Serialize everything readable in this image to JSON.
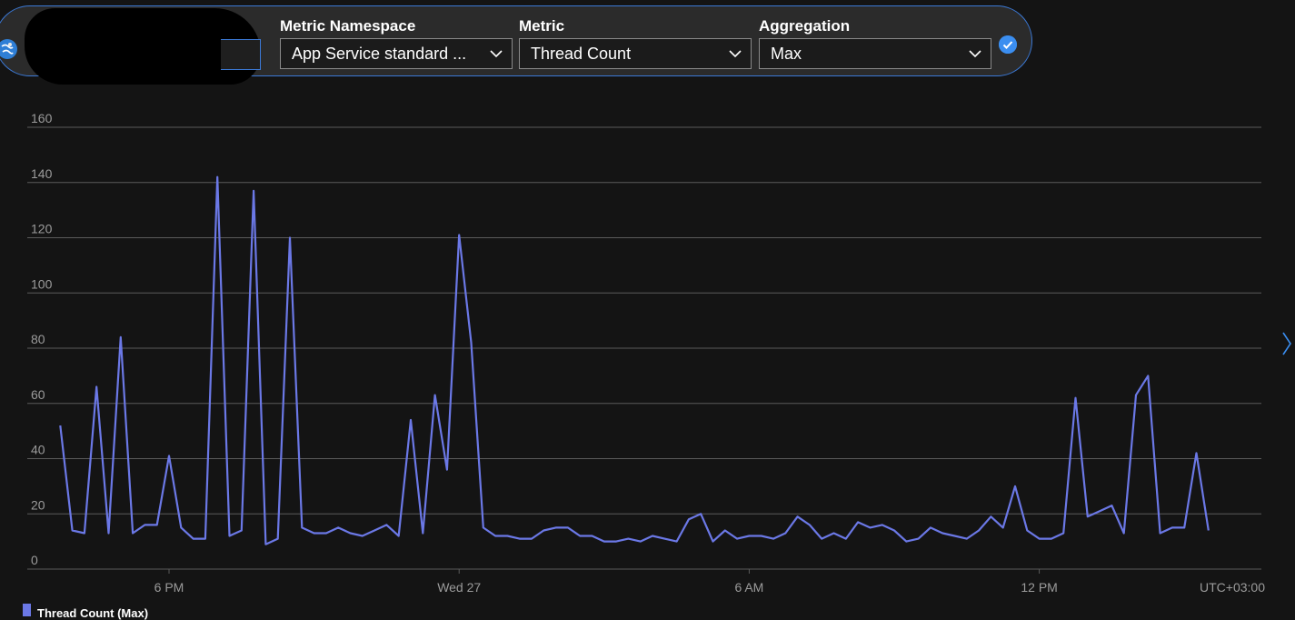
{
  "picker": {
    "namespace_label": "Metric Namespace",
    "namespace_value": "App Service standard ...",
    "metric_label": "Metric",
    "metric_value": "Thread Count",
    "aggregation_label": "Aggregation",
    "aggregation_value": "Max"
  },
  "icons": {
    "resource": "app-service-globe-icon",
    "dropdown": "chevron-down-icon",
    "confirm": "checkmark-circle-icon",
    "next": "chevron-right-icon"
  },
  "colors": {
    "series": "#6b78e6",
    "accent": "#3b8ef0",
    "background": "#141414"
  },
  "chart_data": {
    "type": "line",
    "title": "",
    "xlabel": "",
    "ylabel": "",
    "timezone_label": "UTC+03:00",
    "ylim": [
      0,
      160
    ],
    "yticks": [
      0,
      20,
      40,
      60,
      80,
      100,
      120,
      140,
      160
    ],
    "xticks": [
      {
        "label": "6 PM",
        "t": 18
      },
      {
        "label": "Wed 27",
        "t": 24
      },
      {
        "label": "6 AM",
        "t": 30
      },
      {
        "label": "12 PM",
        "t": 36
      }
    ],
    "x_start_hour": 15.75,
    "x_step_hours": 0.25,
    "grid": true,
    "legend_position": "bottom-left",
    "series": [
      {
        "name": "Thread Count (Max)",
        "values": [
          52,
          14,
          13,
          66,
          13,
          84,
          13,
          16,
          16,
          41,
          15,
          11,
          11,
          142,
          12,
          14,
          137,
          9,
          11,
          120,
          15,
          13,
          13,
          15,
          13,
          12,
          14,
          16,
          12,
          54,
          13,
          63,
          36,
          121,
          82,
          15,
          12,
          12,
          11,
          11,
          14,
          15,
          15,
          12,
          12,
          10,
          10,
          11,
          10,
          12,
          11,
          10,
          18,
          20,
          10,
          14,
          11,
          12,
          12,
          11,
          13,
          19,
          16,
          11,
          13,
          11,
          17,
          15,
          16,
          14,
          10,
          11,
          15,
          13,
          12,
          11,
          14,
          19,
          15,
          30,
          14,
          11,
          11,
          13,
          62,
          19,
          21,
          23,
          13,
          63,
          70,
          13,
          15,
          15,
          42,
          14
        ]
      }
    ]
  }
}
